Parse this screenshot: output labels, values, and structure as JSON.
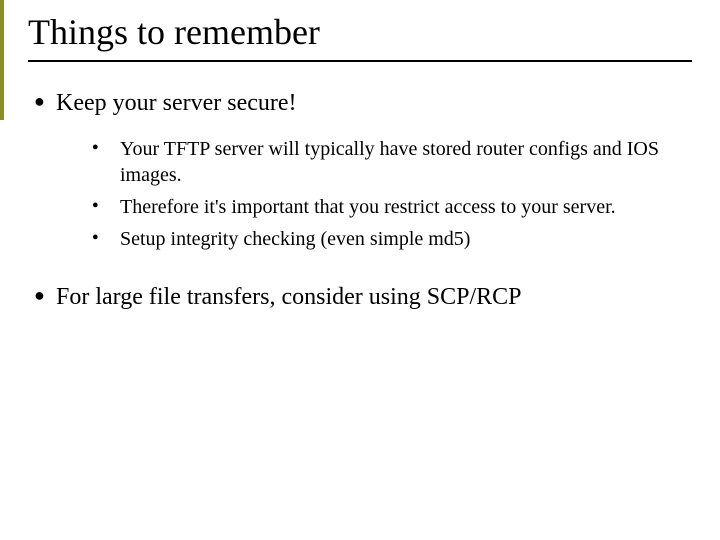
{
  "slide": {
    "title": "Things to remember",
    "bullets": [
      {
        "text": "Keep your server secure!",
        "children": [
          "Your TFTP server will typically have stored router configs and IOS images.",
          "Therefore it's important that you restrict access to your server.",
          "Setup integrity checking (even simple md5)"
        ]
      },
      {
        "text": "For large file transfers, consider using SCP/RCP",
        "children": []
      }
    ]
  }
}
